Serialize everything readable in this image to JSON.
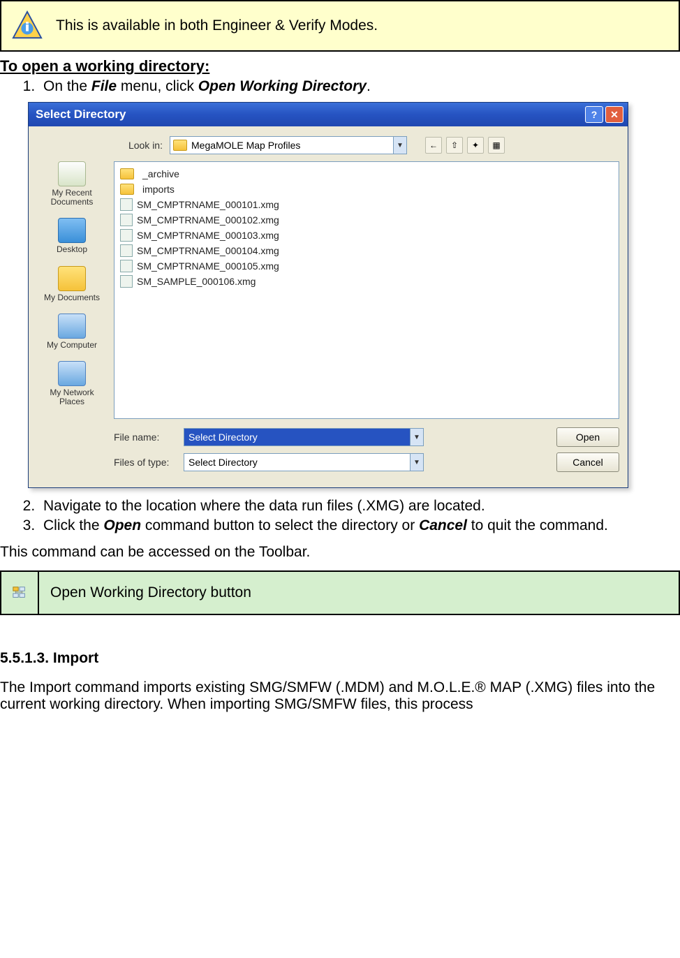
{
  "info_banner": {
    "text": "This is available in both Engineer & Verify Modes."
  },
  "section_heading": "To open a working directory:",
  "steps": {
    "s1_a": "On the ",
    "s1_b": "File",
    "s1_c": " menu, click ",
    "s1_d": "Open Working Directory",
    "s1_e": ".",
    "s2": "Navigate to the location where the data run files (.XMG) are located.",
    "s3_a": "Click the ",
    "s3_b": "Open",
    "s3_c": " command button to select the directory or ",
    "s3_d": "Cancel",
    "s3_e": " to quit the command."
  },
  "dialog": {
    "title": "Select Directory",
    "help_symbol": "?",
    "close_symbol": "✕",
    "lookin_label": "Look in:",
    "lookin_value": "MegaMOLE Map Profiles",
    "toolbar_icons": [
      "back-icon",
      "up-icon",
      "new-folder-icon",
      "views-icon"
    ],
    "places": [
      "My Recent Documents",
      "Desktop",
      "My Documents",
      "My Computer",
      "My Network Places"
    ],
    "files": [
      {
        "type": "folder",
        "name": "_archive"
      },
      {
        "type": "folder",
        "name": "imports"
      },
      {
        "type": "file",
        "name": "SM_CMPTRNAME_000101.xmg"
      },
      {
        "type": "file",
        "name": "SM_CMPTRNAME_000102.xmg"
      },
      {
        "type": "file",
        "name": "SM_CMPTRNAME_000103.xmg"
      },
      {
        "type": "file",
        "name": "SM_CMPTRNAME_000104.xmg"
      },
      {
        "type": "file",
        "name": "SM_CMPTRNAME_000105.xmg"
      },
      {
        "type": "file",
        "name": "SM_SAMPLE_000106.xmg"
      }
    ],
    "filename_label": "File name:",
    "filename_value": "Select Directory",
    "filetype_label": "Files of type:",
    "filetype_value": "Select Directory",
    "open_btn": "Open",
    "cancel_btn": "Cancel"
  },
  "toolbar_note": "This command can be accessed on the Toolbar.",
  "green_box": {
    "text": "Open Working Directory button"
  },
  "import_heading": "5.5.1.3. Import",
  "import_para": "The Import command imports existing SMG/SMFW (.MDM) and M.O.L.E.® MAP (.XMG) files into the current working directory. When importing SMG/SMFW files, this process"
}
